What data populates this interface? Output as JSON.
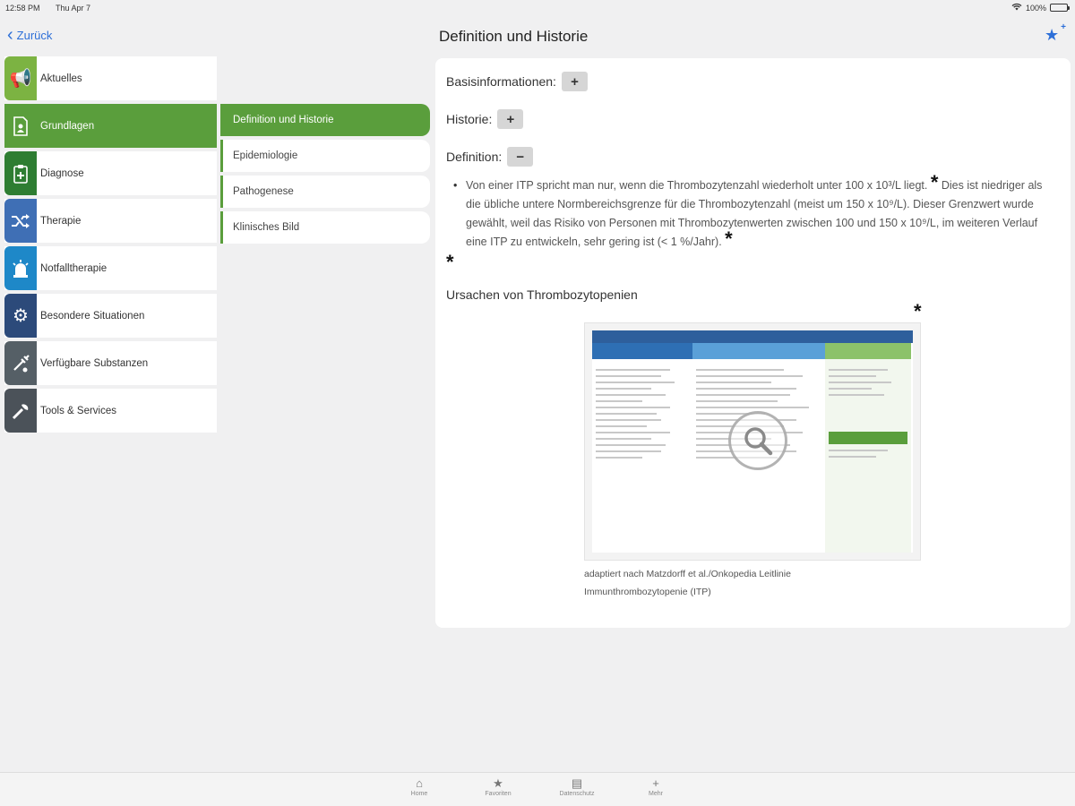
{
  "status": {
    "time": "12:58 PM",
    "date": "Thu Apr 7",
    "battery": "100%"
  },
  "nav": {
    "back_label": "Zurück",
    "title": "Definition und Historie"
  },
  "sidebar": {
    "items": [
      {
        "label": "Aktuelles",
        "icon": "megaphone-icon",
        "color": "#7cb342",
        "glyph": "📢"
      },
      {
        "label": "Grundlagen",
        "icon": "document-icon",
        "color": "#5a9e3c",
        "glyph": "📄"
      },
      {
        "label": "Diagnose",
        "icon": "clipboard-icon",
        "color": "#2e7d32",
        "glyph": "📋"
      },
      {
        "label": "Therapie",
        "icon": "shuffle-icon",
        "color": "#3f6fb5",
        "glyph": "⤨"
      },
      {
        "label": "Notfalltherapie",
        "icon": "siren-icon",
        "color": "#1e88c8",
        "glyph": "🚨"
      },
      {
        "label": "Besondere Situationen",
        "icon": "gear-icon",
        "color": "#2c4a7a",
        "glyph": "⚙"
      },
      {
        "label": "Verfügbare Substanzen",
        "icon": "syringe-icon",
        "color": "#555f66",
        "glyph": "✎"
      },
      {
        "label": "Tools & Services",
        "icon": "wrench-icon",
        "color": "#4b5259",
        "glyph": "🔧"
      }
    ]
  },
  "submenu": {
    "items": [
      {
        "label": "Definition und Historie"
      },
      {
        "label": "Epidemiologie"
      },
      {
        "label": "Pathogenese"
      },
      {
        "label": "Klinisches Bild"
      }
    ]
  },
  "content": {
    "basis_label": "Basisinformationen:",
    "historie_label": "Historie:",
    "definition_label": "Definition:",
    "plus": "+",
    "minus": "−",
    "para_part1": "Von einer ITP spricht man nur, wenn die Thrombozytenzahl wiederholt unter 100 x 10³/L liegt.",
    "para_part2": "Dies ist niedriger als die übliche untere Normbereichsgrenze für die Thrombozytenzahl (meist um 150 x 10⁹/L). Dieser Grenzwert wurde gewählt, weil das Risiko von Personen mit Thrombozytenwerten zwischen 100 und 150 x 10⁹/L, im weiteren Verlauf eine ITP zu entwickeln, sehr gering ist (< 1 %/Jahr).",
    "asterisk": "*",
    "subheading": "Ursachen von Thrombozytopenien",
    "caption_line1": "adaptiert nach Matzdorff et al./Onkopedia Leitlinie",
    "caption_line2": "Immunthrombozytopenie (ITP)"
  },
  "tabbar": {
    "items": [
      {
        "label": "Home",
        "glyph": "⌂",
        "icon": "home-icon"
      },
      {
        "label": "Favoriten",
        "glyph": "★",
        "icon": "star-icon"
      },
      {
        "label": "Datenschutz",
        "glyph": "▤",
        "icon": "document-icon"
      },
      {
        "label": "Mehr",
        "glyph": "+",
        "icon": "plus-icon"
      }
    ]
  }
}
